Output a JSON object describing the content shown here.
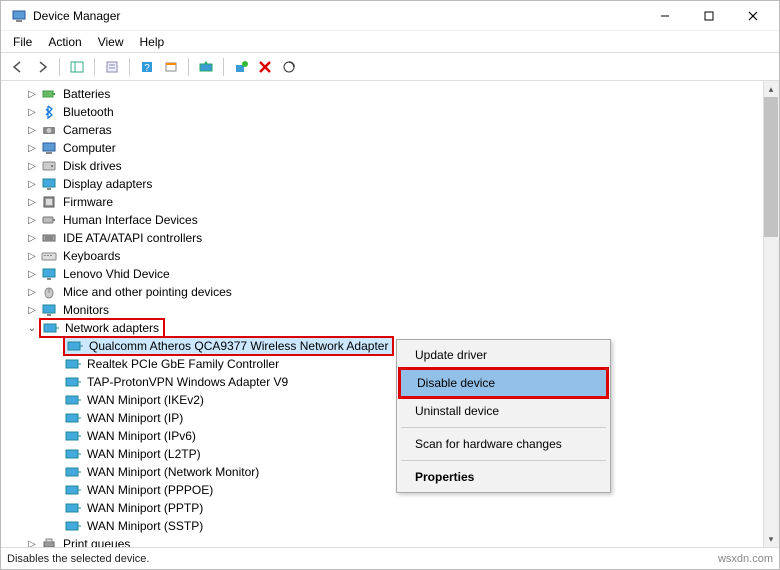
{
  "title": "Device Manager",
  "menu": {
    "file": "File",
    "action": "Action",
    "view": "View",
    "help": "Help"
  },
  "categories": [
    {
      "icon": "battery",
      "label": "Batteries"
    },
    {
      "icon": "bluetooth",
      "label": "Bluetooth"
    },
    {
      "icon": "camera",
      "label": "Cameras"
    },
    {
      "icon": "computer",
      "label": "Computer"
    },
    {
      "icon": "disk",
      "label": "Disk drives"
    },
    {
      "icon": "display",
      "label": "Display adapters"
    },
    {
      "icon": "firmware",
      "label": "Firmware"
    },
    {
      "icon": "hid",
      "label": "Human Interface Devices"
    },
    {
      "icon": "ide",
      "label": "IDE ATA/ATAPI controllers"
    },
    {
      "icon": "keyboard",
      "label": "Keyboards"
    },
    {
      "icon": "display",
      "label": "Lenovo Vhid Device"
    },
    {
      "icon": "mouse",
      "label": "Mice and other pointing devices"
    },
    {
      "icon": "monitor",
      "label": "Monitors"
    }
  ],
  "network": {
    "label": "Network adapters",
    "children": [
      "Qualcomm Atheros QCA9377 Wireless Network Adapter",
      "Realtek PCIe GbE Family Controller",
      "TAP-ProtonVPN Windows Adapter V9",
      "WAN Miniport (IKEv2)",
      "WAN Miniport (IP)",
      "WAN Miniport (IPv6)",
      "WAN Miniport (L2TP)",
      "WAN Miniport (Network Monitor)",
      "WAN Miniport (PPPOE)",
      "WAN Miniport (PPTP)",
      "WAN Miniport (SSTP)"
    ]
  },
  "after": {
    "label": "Print queues"
  },
  "ctx": {
    "update": "Update driver",
    "disable": "Disable device",
    "uninstall": "Uninstall device",
    "scan": "Scan for hardware changes",
    "props": "Properties"
  },
  "status": "Disables the selected device.",
  "watermark": "wsxdn.com"
}
